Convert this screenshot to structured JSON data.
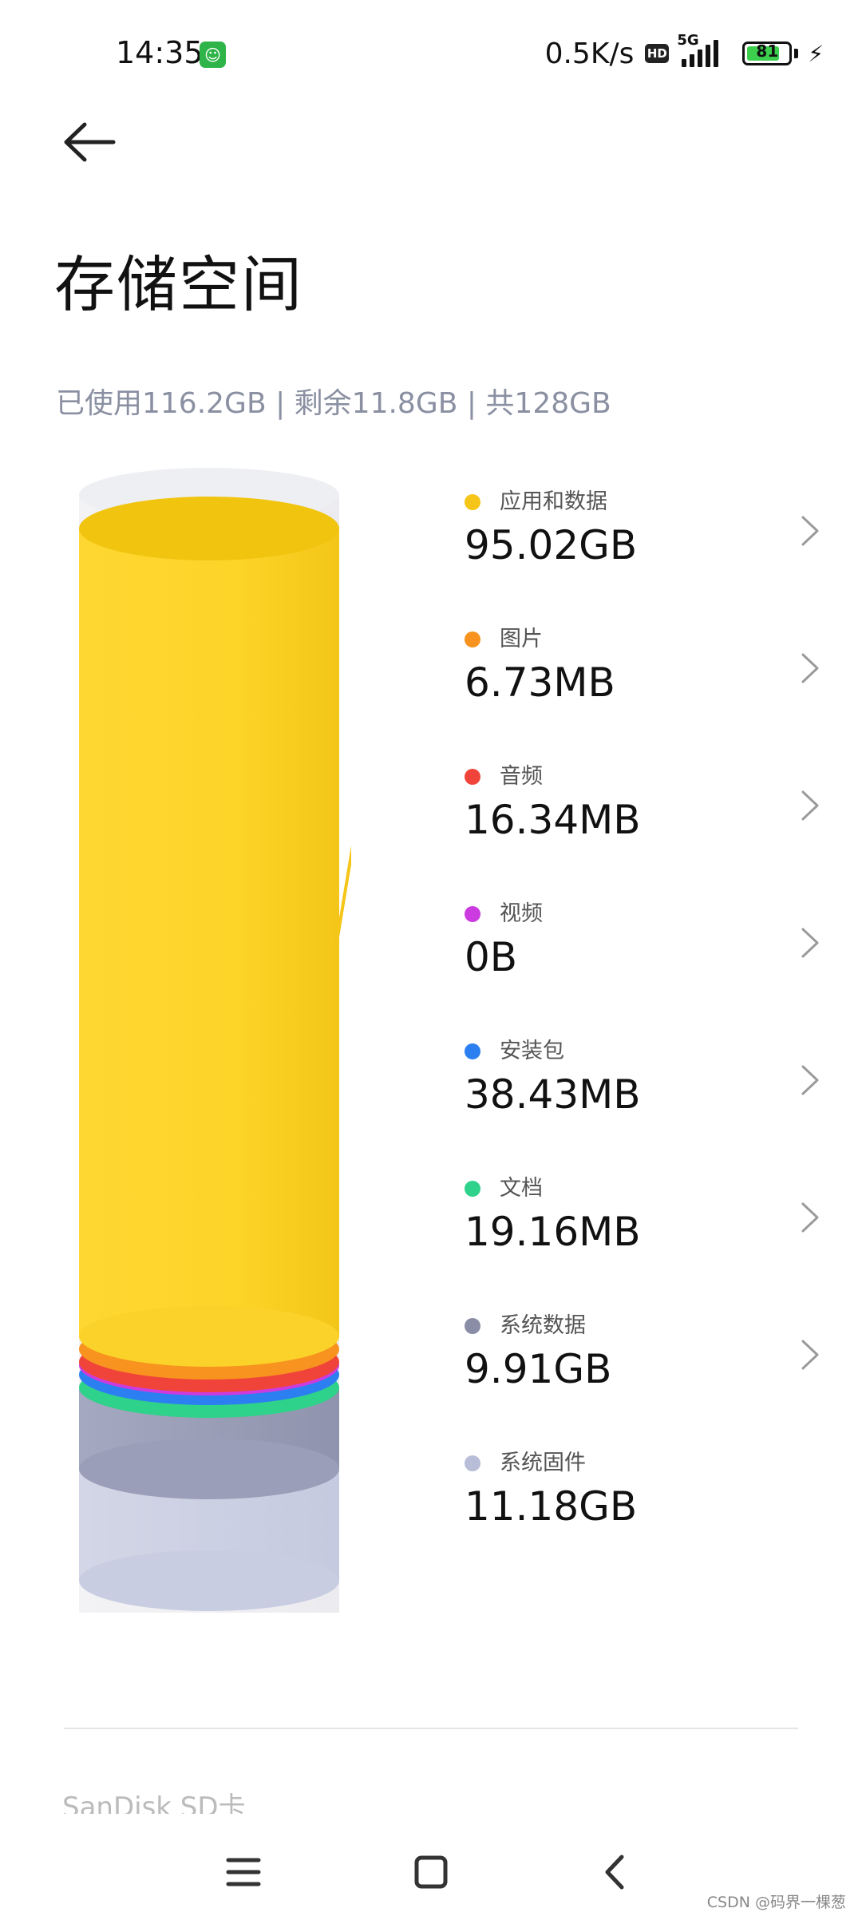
{
  "status_bar": {
    "time": "14:35",
    "app_icon": "android-robot-icon",
    "net_speed": "0.5K/s",
    "hd_label": "HD",
    "network": "5G",
    "battery": "81",
    "battery_level_percent": 81
  },
  "header": {
    "back_icon": "arrow-left-icon",
    "title": "存储空间"
  },
  "summary": "已使用116.2GB | 剩余11.8GB | 共128GB",
  "chart_data": {
    "type": "stacked-cylinder",
    "total": "128GB",
    "items": [
      {
        "label": "应用和数据",
        "value": "95.02GB",
        "color": "#f5c518"
      },
      {
        "label": "图片",
        "value": "6.73MB",
        "color": "#f7931e"
      },
      {
        "label": "音频",
        "value": "16.34MB",
        "color": "#f0443a"
      },
      {
        "label": "视频",
        "value": "0B",
        "color": "#cc3be0"
      },
      {
        "label": "安装包",
        "value": "38.43MB",
        "color": "#2b7ff0"
      },
      {
        "label": "文档",
        "value": "19.16MB",
        "color": "#2fd28a"
      },
      {
        "label": "系统数据",
        "value": "9.91GB",
        "color": "#8a8da6"
      },
      {
        "label": "系统固件",
        "value": "11.18GB",
        "color": "#b8bdd8"
      }
    ]
  },
  "footer": {
    "sd_label": "SanDisk SD卡"
  },
  "nav": {
    "menu_icon": "menu-icon",
    "home_icon": "home-square-icon",
    "back_icon": "back-chevron-icon"
  },
  "watermark": "CSDN @码界一棵葱"
}
